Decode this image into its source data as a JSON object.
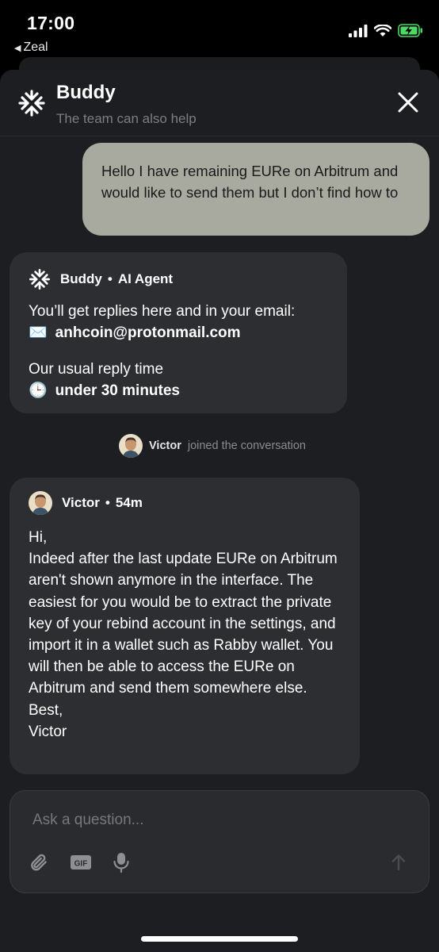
{
  "status_bar": {
    "time": "17:00",
    "back_app": "Zeal",
    "icons": [
      "signal-icon",
      "wifi-icon",
      "battery-charging-icon"
    ]
  },
  "header": {
    "title": "Buddy",
    "subtitle": "The team can also help",
    "close_icon": "close-icon"
  },
  "messages": {
    "user": "Hello I have remaining EURe on Arbitrum and would like to send them but I don’t find how to",
    "agent": {
      "name": "Buddy",
      "separator": "•",
      "role": "AI Agent",
      "replies_text": "You’ll get replies here and in your email:",
      "email_emoji": "✉️",
      "email": "anhcoin@protonmail.com",
      "reply_time_label": "Our usual reply time",
      "clock_emoji": "🕒",
      "reply_time": "under 30 minutes"
    },
    "joined": {
      "name": "Victor",
      "text": "joined the conversation"
    },
    "victor": {
      "name": "Victor",
      "separator": "•",
      "time": "54m",
      "body": "Hi,\nIndeed after the last update EURe on Arbitrum aren't shown anymore in the interface. The easiest for you would be to extract the private key of your rebind account in the settings, and import it in a wallet such as Rabby wallet. You will then be able to access the EURe on Arbitrum and send them somewhere else.\nBest,\nVictor"
    }
  },
  "composer": {
    "placeholder": "Ask a question...",
    "value": "",
    "tools": [
      "paperclip-icon",
      "gif-icon",
      "microphone-icon",
      "send-arrow-icon"
    ]
  },
  "colors": {
    "sheet_bg": "#1d1e21",
    "card_bg": "#2d2e31",
    "user_bubble_bg": "#a8a99f",
    "battery_green": "#4cd964"
  }
}
